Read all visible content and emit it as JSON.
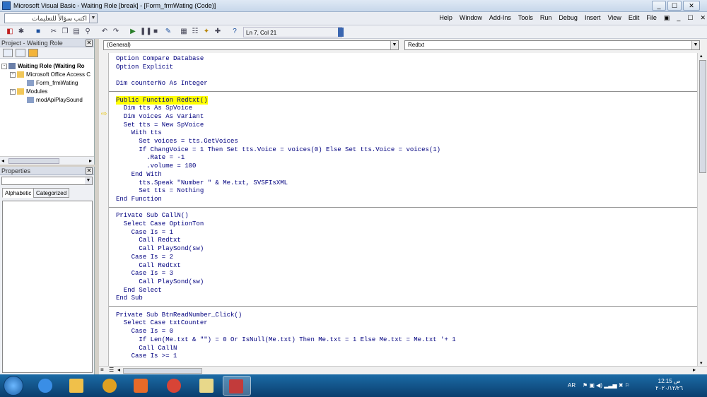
{
  "window": {
    "title": "Microsoft Visual Basic - Waiting Role [break] - [Form_frmWating (Code)]",
    "controls": [
      "_",
      "☐",
      "✕"
    ]
  },
  "menubar": {
    "help_box_text": "اكتب سؤالاً للتعليمات",
    "items": [
      "Help",
      "Window",
      "Add-Ins",
      "Tools",
      "Run",
      "Debug",
      "Insert",
      "View",
      "Edit",
      "File"
    ],
    "mdi_controls": [
      "_",
      "☐",
      "✕"
    ]
  },
  "toolbar": {
    "position": "Ln 7, Col 21"
  },
  "project": {
    "title": "Project - Waiting Role",
    "close": "✕",
    "tree": [
      {
        "label": "Waiting Role (Waiting Ro",
        "level": 0,
        "expander": "-",
        "icon": "vba-project-icon",
        "bold": true
      },
      {
        "label": "Microsoft Office Access C",
        "level": 1,
        "expander": "-",
        "icon": "folder-icon",
        "bold": false
      },
      {
        "label": "Form_frmWating",
        "level": 2,
        "expander": "",
        "icon": "form-module-icon",
        "bold": false
      },
      {
        "label": "Modules",
        "level": 1,
        "expander": "-",
        "icon": "folder-icon",
        "bold": false
      },
      {
        "label": "modApiPlaySound",
        "level": 2,
        "expander": "",
        "icon": "module-icon",
        "bold": false
      }
    ]
  },
  "properties": {
    "title": "Properties",
    "close": "✕",
    "tabs": [
      "Alphabetic",
      "Categorized"
    ]
  },
  "code_window": {
    "object_combo": "(General)",
    "procedure_combo": "Redtxt",
    "lines": [
      "Option Compare Database",
      "Option Explicit",
      "",
      "Dim counterNo As Integer",
      "",
      "Public Function Redtxt()",
      "  Dim tts As SpVoice",
      "  Dim voices As Variant",
      "  Set tts = New SpVoice",
      "    With tts",
      "      Set voices = tts.GetVoices",
      "      If ChangVoice = 1 Then Set tts.Voice = voices(0) Else Set tts.Voice = voices(1)",
      "        .Rate = -1",
      "        .volume = 100",
      "    End With",
      "      tts.Speak \"Number \" & Me.txt, SVSFIsXML",
      "      Set tts = Nothing",
      "End Function",
      "",
      "Private Sub CallN()",
      "  Select Case OptionTon",
      "    Case Is = 1",
      "      Call Redtxt",
      "      Call PlaySond(sw)",
      "    Case Is = 2",
      "      Call Redtxt",
      "    Case Is = 3",
      "      Call PlaySond(sw)",
      "  End Select",
      "End Sub",
      "",
      "Private Sub BtnReadNumber_Click()",
      "  Select Case txtCounter",
      "    Case Is = 0",
      "      If Len(Me.txt & \"\") = 0 Or IsNull(Me.txt) Then Me.txt = 1 Else Me.txt = Me.txt '+ 1",
      "      Call CallN",
      "    Case Is >= 1"
    ],
    "highlighted_line": 5,
    "divider_after": [
      3,
      17,
      29
    ]
  },
  "taskbar": {
    "lang": "AR",
    "time": "12:15 ص",
    "date": "٢٠٢٠/١٢/٢٦",
    "apps": [
      "ie-icon",
      "explorer-icon",
      "chrome-icon",
      "media-player-icon",
      "chrome-icon",
      "paint-icon",
      "access-icon"
    ]
  }
}
